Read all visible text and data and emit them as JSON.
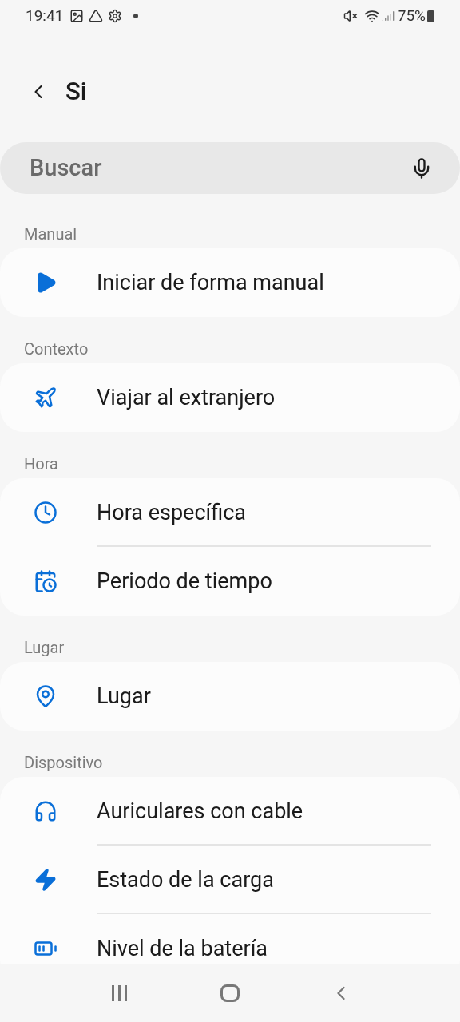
{
  "status_bar": {
    "time": "19:41",
    "battery": "75%"
  },
  "header": {
    "title": "Si"
  },
  "search": {
    "placeholder": "Buscar"
  },
  "sections": [
    {
      "title": "Manual",
      "items": [
        {
          "label": "Iniciar de forma manual",
          "kind": "play"
        }
      ]
    },
    {
      "title": "Contexto",
      "items": [
        {
          "label": "Viajar al extranjero",
          "kind": "plane"
        }
      ]
    },
    {
      "title": "Hora",
      "items": [
        {
          "label": "Hora específica",
          "kind": "clock"
        },
        {
          "label": "Periodo de tiempo",
          "kind": "calendar"
        }
      ]
    },
    {
      "title": "Lugar",
      "items": [
        {
          "label": "Lugar",
          "kind": "pin"
        }
      ]
    },
    {
      "title": "Dispositivo",
      "items": [
        {
          "label": "Auriculares con cable",
          "kind": "headphones"
        },
        {
          "label": "Estado de la carga",
          "kind": "bolt"
        },
        {
          "label": "Nivel de la batería",
          "kind": "battery"
        }
      ]
    }
  ]
}
